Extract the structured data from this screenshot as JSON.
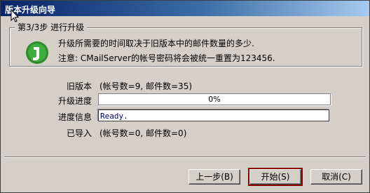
{
  "window": {
    "title": "版本升级向导"
  },
  "step": {
    "title": "第3/3步  进行升级",
    "message": "升级所需要的时间取决于旧版本中的邮件数量的多少.",
    "note": "注意: CMailServer的帐号密码将会被统一重置为123456."
  },
  "rows": {
    "old_version_label": "旧版本",
    "old_version_value": "(帐号数=9, 邮件数=35)",
    "progress_label": "升级进度",
    "progress_text": "0%",
    "progress_value": 0,
    "info_label": "进度信息",
    "info_value": "Ready.",
    "imported_label": "已导入",
    "imported_value": "(帐号数=0, 邮件数=0)"
  },
  "buttons": {
    "back_label": "上一步(B)",
    "start_label": "开始(S)",
    "cancel_label": "取消(C)"
  },
  "colors": {
    "titlebar_start": "#0a246a",
    "titlebar_end": "#a6caf0",
    "logo": "#2e8b2e",
    "default_button_border": "#8b0000"
  },
  "icons": {
    "logo": "cmailserver-logo-icon",
    "cursor": "mouse-pointer-icon"
  }
}
